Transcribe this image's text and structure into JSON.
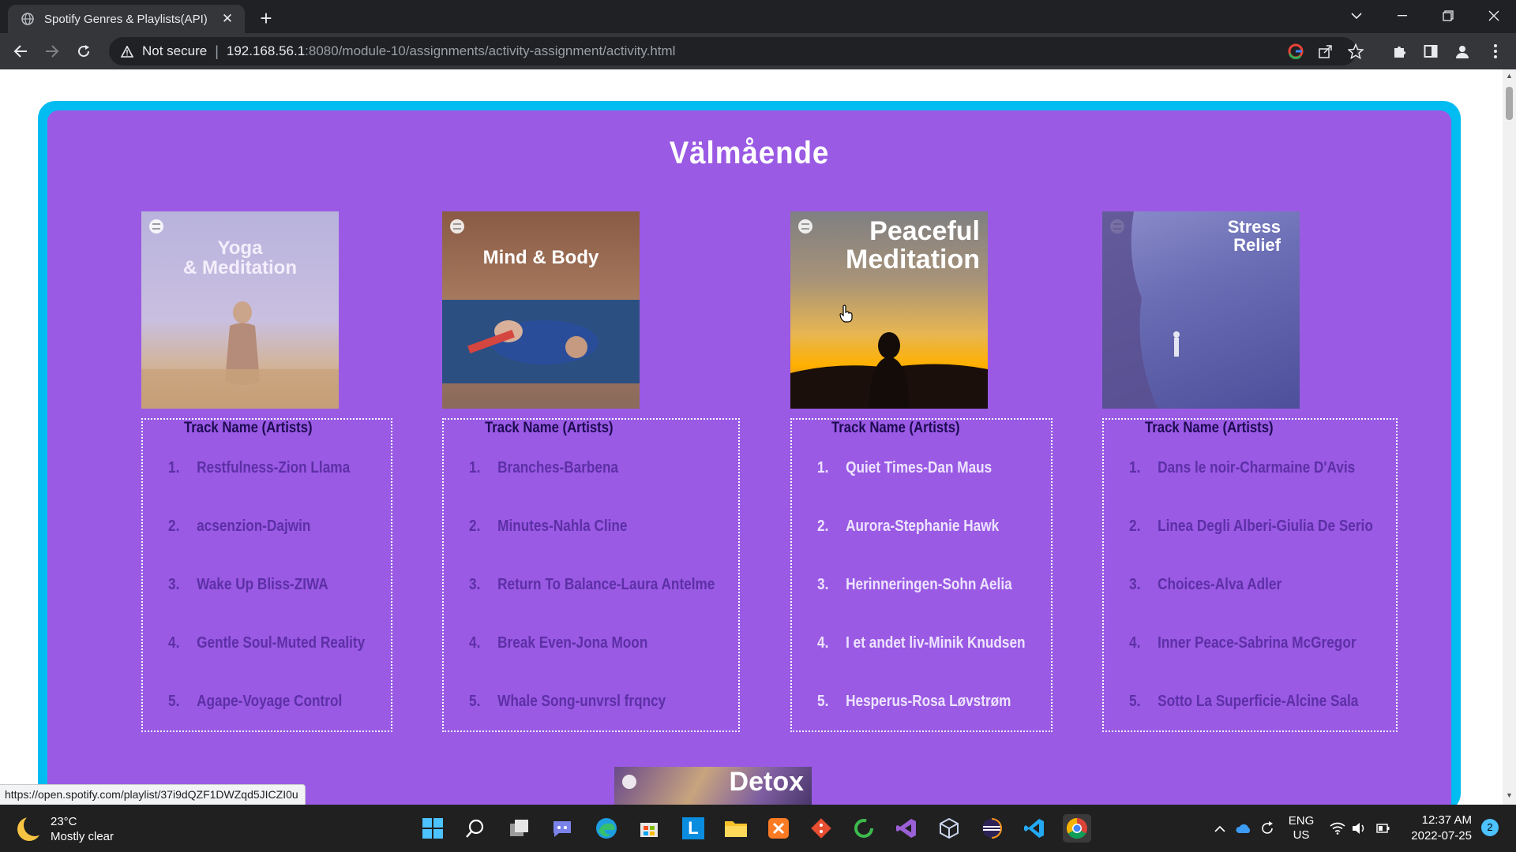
{
  "browser": {
    "tab_title": "Spotify Genres & Playlists(API)",
    "tab_close": "✕",
    "new_tab": "+",
    "not_secure": "Not secure",
    "url_host": "192.168.56.1",
    "url_path": ":8080/module-10/assignments/activity-assignment/activity.html",
    "status_url": "https://open.spotify.com/playlist/37i9dQZF1DWZqd5JICZI0u"
  },
  "page": {
    "heading": "Välmående",
    "playlists": [
      {
        "cover_title": "Yoga\n& Meditation",
        "track_header": "Track Name (Artists)",
        "tracks": [
          {
            "num": "1.",
            "name": "Restfulness-Zion Llama"
          },
          {
            "num": "2.",
            "name": "acsenzion-Dajwin"
          },
          {
            "num": "3.",
            "name": "Wake Up Bliss-ZIWA"
          },
          {
            "num": "4.",
            "name": "Gentle Soul-Muted Reality"
          },
          {
            "num": "5.",
            "name": "Agape-Voyage Control"
          }
        ]
      },
      {
        "cover_title": "Mind & Body",
        "track_header": "Track Name (Artists)",
        "tracks": [
          {
            "num": "1.",
            "name": "Branches-Barbena"
          },
          {
            "num": "2.",
            "name": "Minutes-Nahla Cline"
          },
          {
            "num": "3.",
            "name": "Return To Balance-Laura Antelme"
          },
          {
            "num": "4.",
            "name": "Break Even-Jona Moon"
          },
          {
            "num": "5.",
            "name": "Whale Song-unvrsl frqncy"
          }
        ]
      },
      {
        "cover_title": "Peaceful\nMeditation",
        "track_header": "Track Name (Artists)",
        "tracks": [
          {
            "num": "1.",
            "name": "Quiet Times-Dan Maus"
          },
          {
            "num": "2.",
            "name": "Aurora-Stephanie Hawk"
          },
          {
            "num": "3.",
            "name": "Herinneringen-Sohn Aelia"
          },
          {
            "num": "4.",
            "name": "I et andet liv-Minik Knudsen"
          },
          {
            "num": "5.",
            "name": "Hesperus-Rosa Løvstrøm"
          }
        ]
      },
      {
        "cover_title": "Stress\nRelief",
        "track_header": "Track Name (Artists)",
        "tracks": [
          {
            "num": "1.",
            "name": "Dans le noir-Charmaine D'Avis"
          },
          {
            "num": "2.",
            "name": "Linea Degli Alberi-Giulia De Serio"
          },
          {
            "num": "3.",
            "name": "Choices-Alva Adler"
          },
          {
            "num": "4.",
            "name": "Inner Peace-Sabrina McGregor"
          },
          {
            "num": "5.",
            "name": "Sotto La Superficie-Alcine Sala"
          }
        ]
      }
    ],
    "next_cover_title": "Detox"
  },
  "taskbar": {
    "temp": "23°C",
    "condition": "Mostly clear",
    "lang1": "ENG",
    "lang2": "US",
    "time": "12:37 AM",
    "date": "2022-07-25",
    "notifications": "2"
  },
  "colors": {
    "panel": "#9a5ae4",
    "frame": "#00bcf0",
    "track_text": "#5d2fa6",
    "header_text": "#1d0b52"
  }
}
